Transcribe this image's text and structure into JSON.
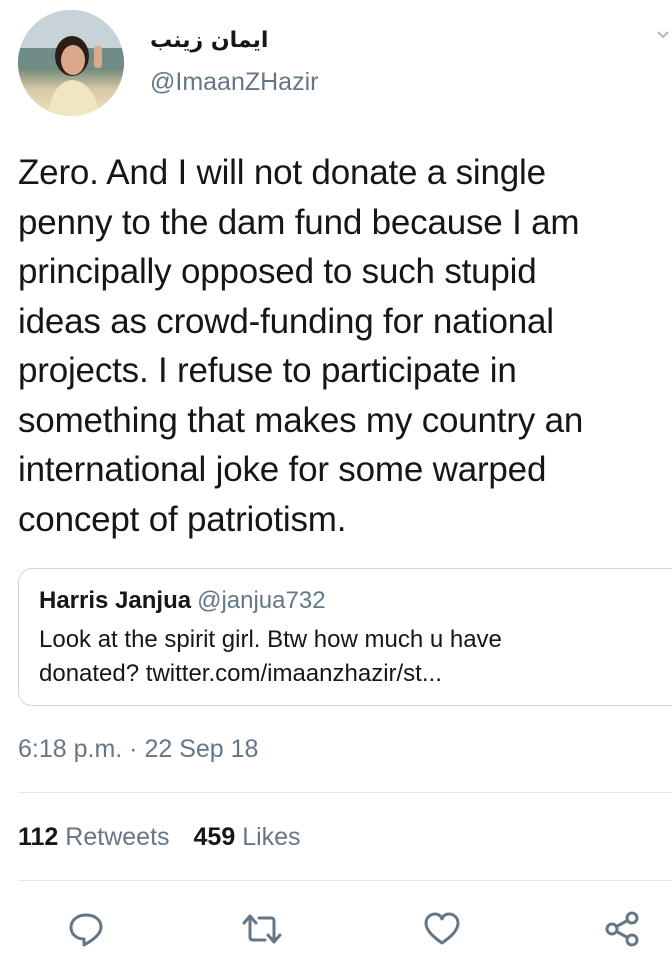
{
  "author": {
    "name": "ایمان زینب",
    "handle": "@ImaanZHazir"
  },
  "tweet": {
    "lines": [
      "Zero. And I will not donate a single",
      "penny to the dam fund because I am",
      "principally opposed to such stupid",
      "ideas as crowd-funding for national",
      "projects. I refuse to participate in",
      "something that makes my country an",
      "international joke for some warped",
      "concept of patriotism."
    ]
  },
  "quoted_tweet": {
    "name": "Harris Janjua",
    "handle": "@janjua732",
    "lines": [
      "Look at the spirit girl. Btw how much u have",
      "donated? twitter.com/imaanzhazir/st..."
    ]
  },
  "timestamp": "6:18 p.m. · 22 Sep 18",
  "stats": {
    "retweets_count": "112",
    "retweets_label": "Retweets",
    "likes_count": "459",
    "likes_label": "Likes"
  },
  "actions": [
    "reply-icon",
    "retweet-icon",
    "like-icon",
    "share-icon"
  ],
  "colors": {
    "text": "#14171a",
    "secondary": "#657786",
    "border": "#ccd6dd",
    "divider": "#e1e8ed",
    "action_icon": "#657786"
  }
}
